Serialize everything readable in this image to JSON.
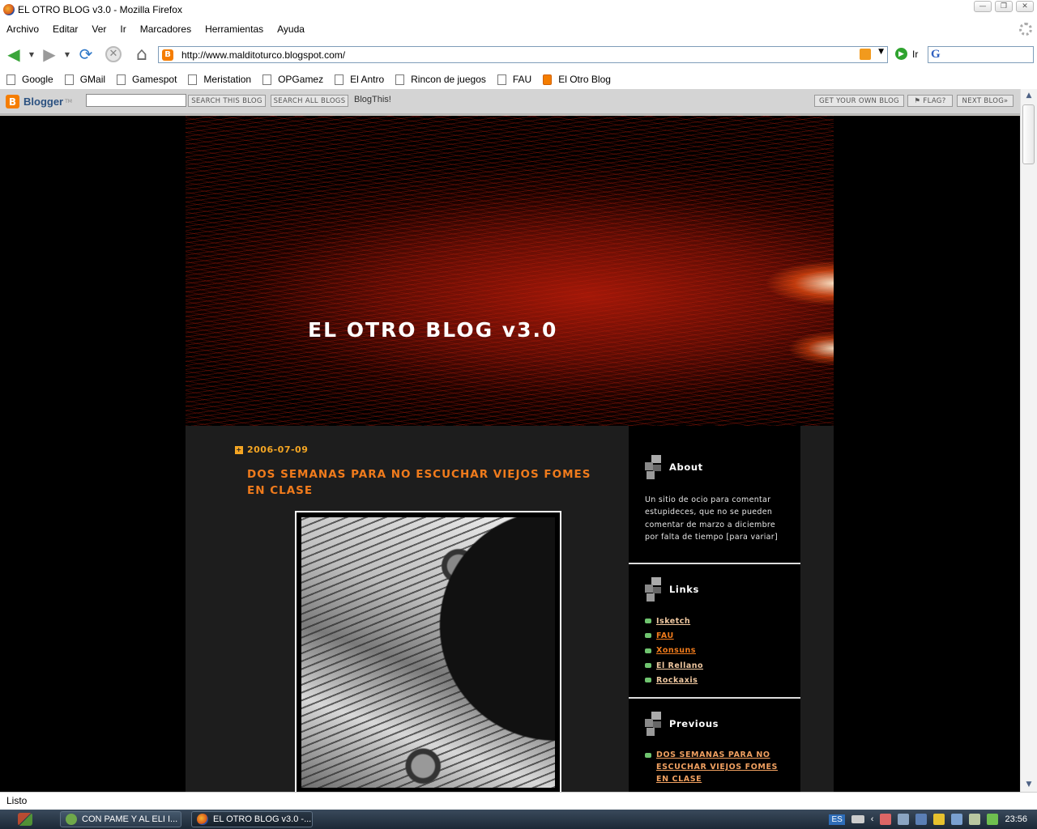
{
  "window": {
    "title": "EL OTRO BLOG v3.0 - Mozilla Firefox",
    "controls": [
      "—",
      "❐",
      "✕"
    ]
  },
  "menu": [
    "Archivo",
    "Editar",
    "Ver",
    "Ir",
    "Marcadores",
    "Herramientas",
    "Ayuda"
  ],
  "nav": {
    "url": "http://www.malditoturco.blogspot.com/",
    "go_label": "Ir",
    "search_engine_glyph": "G"
  },
  "bookmarks": [
    "Google",
    "GMail",
    "Gamespot",
    "Meristation",
    "OPGamez",
    "El Antro",
    "Rincon de juegos",
    "FAU",
    "El Otro Blog"
  ],
  "blogger_bar": {
    "logo": "Blogger",
    "tm": "TM",
    "search_this": "SEARCH THIS BLOG",
    "search_all": "SEARCH ALL BLOGS",
    "blogthis": "BlogThis!",
    "get_blog": "GET YOUR OWN BLOG",
    "flag": "FLAG?",
    "next_blog": "NEXT BLOG»"
  },
  "blog": {
    "title": "EL OTRO BLOG v3.0",
    "post": {
      "date": "2006-07-09",
      "title": "DOS SEMANAS PARA NO ESCUCHAR VIEJOS FOMES EN CLASE"
    },
    "sidebar": {
      "about_title": "About",
      "about_text": "Un sitio de ocio para comentar estupideces, que no se pueden comentar de marzo a diciembre por falta de tiempo [para variar]",
      "links_title": "Links",
      "links": [
        {
          "label": "Isketch",
          "color": "#f0c8a0"
        },
        {
          "label": "FAU",
          "color": "#f07b1c"
        },
        {
          "label": "Xonsuns",
          "color": "#f07b1c"
        },
        {
          "label": "El Rellano",
          "color": "#f0c8a0"
        },
        {
          "label": "Rockaxis",
          "color": "#f0c8a0"
        }
      ],
      "previous_title": "Previous",
      "previous_items": [
        "DOS SEMANAS PARA NO ESCUCHAR VIEJOS FOMES EN CLASE"
      ]
    }
  },
  "status": "Listo",
  "taskbar": {
    "tasks": [
      "CON PAME Y AL ELI I...",
      "EL OTRO BLOG v3.0 -..."
    ],
    "lang": "ES",
    "clock": "23:56"
  },
  "colors": {
    "accent_orange": "#f07b1c",
    "date_orange": "#f5a623",
    "link_bullet": "#6fc46f",
    "sidebar_bg": "#000000",
    "main_bg": "#1d1d1d"
  }
}
